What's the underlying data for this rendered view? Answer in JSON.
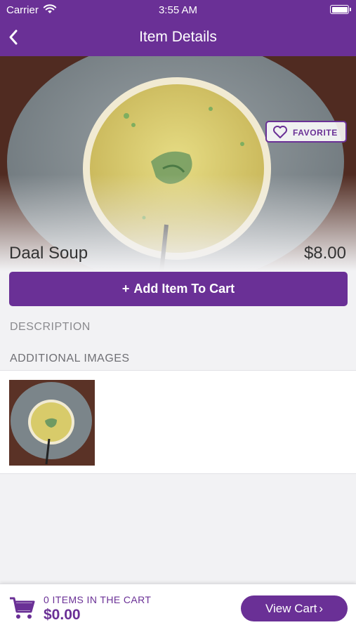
{
  "status_bar": {
    "carrier": "Carrier",
    "time": "3:55 AM"
  },
  "nav": {
    "title": "Item Details",
    "back_icon": "chevron-left-icon"
  },
  "item": {
    "name": "Daal Soup",
    "price": "$8.00",
    "favorite_label": "FAVORITE",
    "favorite_icon": "heart-outline-icon"
  },
  "actions": {
    "add_to_cart_icon": "+",
    "add_to_cart_label": "Add Item To Cart"
  },
  "sections": {
    "description_label": "DESCRIPTION",
    "additional_images_label": "ADDITIONAL IMAGES"
  },
  "cart": {
    "count_text": "0 ITEMS IN THE CART",
    "total": "$0.00",
    "view_cart_label": "View Cart",
    "view_cart_chevron": "›",
    "cart_icon": "shopping-cart-icon"
  },
  "colors": {
    "brand": "#6a3096",
    "background": "#f2f2f4"
  }
}
